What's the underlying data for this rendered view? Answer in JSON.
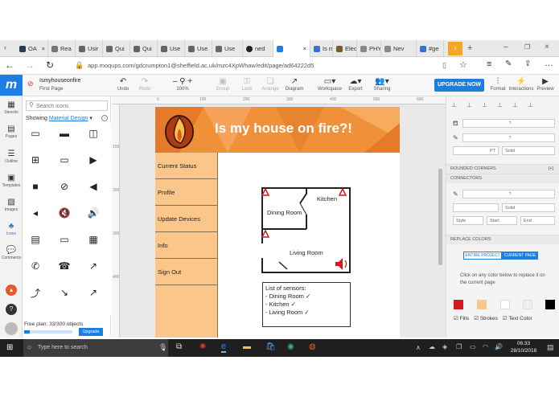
{
  "browser": {
    "tabs": [
      "OA",
      "Rea",
      "Usir",
      "Qui",
      "Qui",
      "Use",
      "Use",
      "Use",
      "ned",
      "",
      "Is m",
      "Elec",
      "PHY",
      "Nev",
      "#ge"
    ],
    "url": "app.moqups.com/gdcrumpton1@sheffield.ac.uk/mzc4XpWhaw/edit/page/ad64222d5"
  },
  "app": {
    "project": "Ismyhouseonfire",
    "page": "First Page",
    "toolbar": {
      "undo": "Undo",
      "redo": "Redo",
      "zoom": "100%",
      "group": "Group",
      "lock": "Lock",
      "arrange": "Arrange",
      "diagram": "Diagram",
      "workspace": "Workspace",
      "export": "Export",
      "sharing": "Sharing",
      "upgrade": "UPGRADE NOW",
      "format": "Format",
      "interactions": "Interactions",
      "preview": "Preview"
    },
    "rail": [
      "Stencils",
      "Pages",
      "Outline",
      "Templates",
      "Images",
      "Icons",
      "Comments"
    ],
    "icons_panel": {
      "search_placeholder": "Search icons",
      "showing": "Showing",
      "library": "Material Design",
      "plan": "Free plan: 33/300 objects",
      "upgrade": "Upgrade"
    },
    "ruler": [
      "0",
      "100",
      "200",
      "300",
      "400",
      "500",
      "600"
    ],
    "vruler": [
      "100",
      "200",
      "300",
      "400"
    ],
    "mockup": {
      "title": "Is my house on fire?!",
      "nav": [
        "Current Status",
        "Profile",
        "Update Devices",
        "Info",
        "Sign Out"
      ],
      "rooms": {
        "kitchen": "Kitchen",
        "dining": "Dining Room",
        "living": "Living Room"
      },
      "sensors_title": "List of sensors:",
      "sensors": [
        "- Dining Room ✓",
        "- Kitchen ✓",
        "- Living Room ✓"
      ]
    },
    "right_panel": {
      "q1": "?",
      "q2": "?",
      "q3": "?",
      "pt": "PT",
      "solid1": "Solid",
      "rounded": "ROUNDED CORNERS",
      "rounded_val": "[+]",
      "connectors": "CONNECTORS",
      "q4": "?",
      "solid2": "Solid",
      "style": "Style",
      "start": "Start",
      "end": "End",
      "replace": "REPLACE COLORS",
      "entire": "ENTIRE PROJECT",
      "current": "CURRENT PAGE",
      "hint": "Click on any color below to replace it on the current page",
      "swatches": [
        "#d11a1a",
        "#fbc68a",
        "#ffffff",
        "#eeeeee",
        "#000000"
      ],
      "fills": "Fills",
      "strokes": "Strokes",
      "textcolor": "Text Color"
    }
  },
  "taskbar": {
    "search": "Type here to search",
    "time": "06:33",
    "date": "28/10/2018"
  }
}
